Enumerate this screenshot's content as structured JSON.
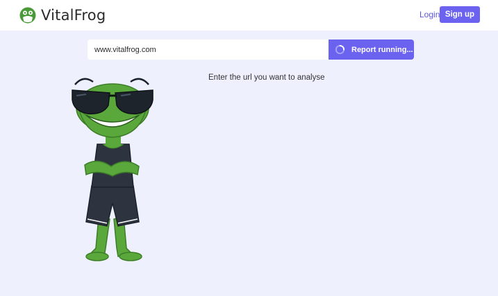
{
  "header": {
    "brand": "VitalFrog",
    "login_label": "Login",
    "signup_label": "Sign up"
  },
  "search": {
    "value": "www.vitalfrog.com",
    "button_label": "Report running..."
  },
  "hint": "Enter the url you want to analyse",
  "colors": {
    "accent": "#6b63f0",
    "background": "#eef1fd",
    "frog_green": "#5aa83c"
  },
  "icons": {
    "logo": "frog-logo-icon",
    "spinner": "loading-spinner-icon"
  }
}
